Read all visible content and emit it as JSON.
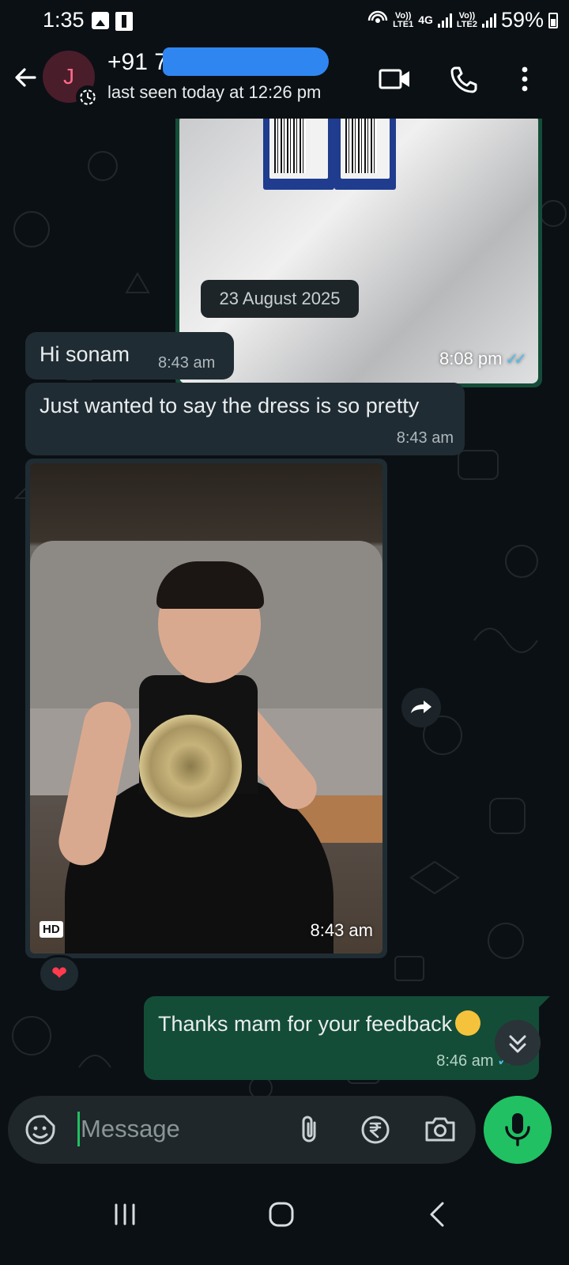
{
  "status_bar": {
    "time": "1:35",
    "volte1": "Vo))",
    "lte1": "LTE1",
    "net_type": "4G",
    "volte2": "Vo))",
    "lte2": "LTE2",
    "battery": "59%"
  },
  "header": {
    "avatar_letter": "J",
    "contact_name": "+91 72",
    "last_seen": "last seen today at 12:26 pm"
  },
  "chat": {
    "top_image_time": "8:08 pm",
    "date_chip": "23 August 2025",
    "messages_in": [
      {
        "text": "Hi sonam",
        "time": "8:43 am"
      },
      {
        "text": "Just wanted to say the dress is so pretty",
        "time": "8:43 am"
      }
    ],
    "image_in": {
      "badge": "HD",
      "time": "8:43 am",
      "reaction": "❤"
    },
    "message_out": {
      "text": "Thanks mam for your feedback",
      "time": "8:46 am"
    }
  },
  "input": {
    "placeholder": "Message"
  },
  "colors": {
    "background": "#0b1014",
    "incoming_bubble": "#202c33",
    "outgoing_bubble": "#144d37",
    "accent_green": "#21c063",
    "read_ticks": "#53bdeb",
    "name_redaction": "#2f86f0"
  },
  "icons": [
    "back-arrow-icon",
    "video-call-icon",
    "voice-call-icon",
    "more-options-icon",
    "disappearing-timer-icon",
    "emoji-sticker-icon",
    "attach-icon",
    "rupee-payment-icon",
    "camera-icon",
    "mic-icon",
    "forward-icon",
    "scroll-down-icon"
  ]
}
